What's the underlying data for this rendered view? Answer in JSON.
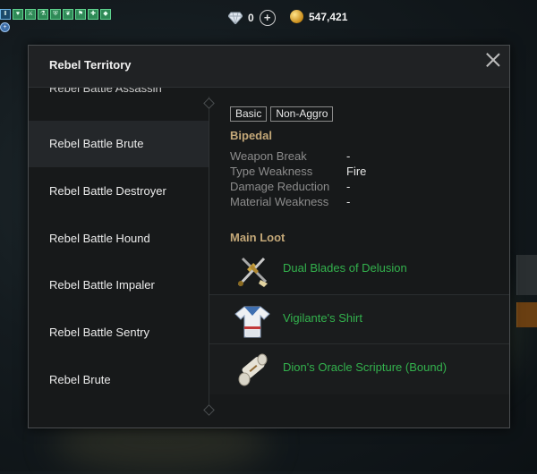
{
  "hud": {
    "status_icons": [
      "hp-buff-icon",
      "shield-buff-icon",
      "sword-buff-icon",
      "potion-buff-icon",
      "defense-buff-icon",
      "leaf-buff-icon",
      "shoe-buff-icon",
      "heal-buff-icon",
      "gem-buff-icon"
    ],
    "gems": "0",
    "gold": "547,421"
  },
  "dialog": {
    "title": "Rebel Territory",
    "monsters": [
      "Rebel Battle Assassin",
      "Rebel Battle Brute",
      "Rebel Battle Destroyer",
      "Rebel Battle Hound",
      "Rebel Battle Impaler",
      "Rebel Battle Sentry",
      "Rebel Brute"
    ],
    "selected_index": 1,
    "detail": {
      "tags": [
        "Basic",
        "Non-Aggro"
      ],
      "category": "Bipedal",
      "stats": [
        {
          "label": "Weapon Break",
          "value": "-"
        },
        {
          "label": "Type Weakness",
          "value": "Fire"
        },
        {
          "label": "Damage Reduction",
          "value": "-"
        },
        {
          "label": "Material Weakness",
          "value": "-"
        }
      ],
      "loot_heading": "Main Loot",
      "loot": [
        {
          "name": "Dual Blades of Delusion",
          "icon": "dual-blades-icon"
        },
        {
          "name": "Vigilante's Shirt",
          "icon": "shirt-icon"
        },
        {
          "name": "Dion's Oracle Scripture (Bound)",
          "icon": "scroll-icon"
        }
      ]
    }
  },
  "colors": {
    "accent_gold": "#c4a878",
    "loot_green": "#33b24d",
    "dialog_bg": "#17191a"
  }
}
